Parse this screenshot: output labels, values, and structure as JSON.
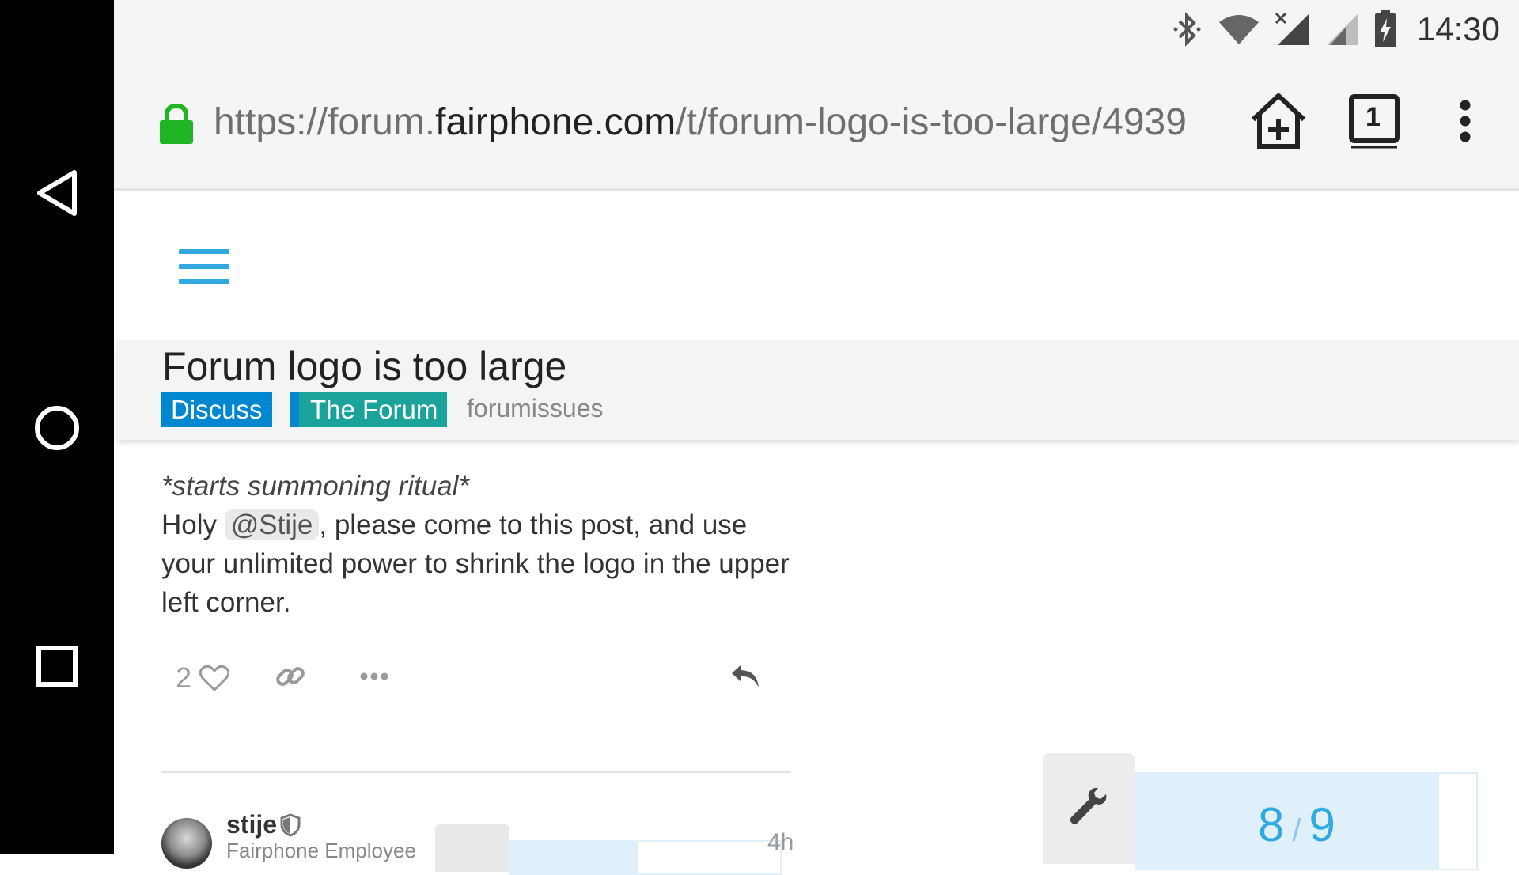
{
  "status": {
    "time": "14:30"
  },
  "browser": {
    "url_prefix": "https://forum.",
    "url_host": "fairphone.com",
    "url_path": "/t/forum-logo-is-too-large/4939",
    "tab_count": "1"
  },
  "topic": {
    "title": "Forum logo is too large",
    "category": "Discuss",
    "subcategory": "The Forum",
    "tag": "forumissues"
  },
  "post": {
    "ritual": "*starts summoning ritual*",
    "body_start": "Holy ",
    "mention": "@Stije",
    "body_end": ", please come to this post, and use your unlimited power to shrink the logo in the upper left corner.",
    "like_count": "2"
  },
  "next_post": {
    "username": "stije",
    "user_title": "Fairphone Employee",
    "age": "4h"
  },
  "progress": {
    "current": "8",
    "total": "9",
    "fraction": 0.89
  },
  "colors": {
    "accent": "#2fa9e0",
    "discuss": "#0087d0",
    "forum": "#1aa39a",
    "lock": "#1fb524"
  }
}
